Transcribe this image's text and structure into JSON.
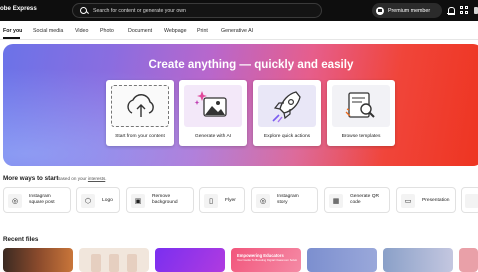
{
  "header": {
    "brand": "obe Express",
    "search_placeholder": "Search for content or generate your own",
    "premium_label": "Premium member"
  },
  "tabs": [
    {
      "label": "For you"
    },
    {
      "label": "Social media"
    },
    {
      "label": "Video"
    },
    {
      "label": "Photo"
    },
    {
      "label": "Document"
    },
    {
      "label": "Webpage"
    },
    {
      "label": "Print"
    },
    {
      "label": "Generative AI"
    }
  ],
  "hero": {
    "title": "Create anything — quickly and easily",
    "cards": [
      {
        "label": "Start from your content",
        "icon": "upload-cloud-icon"
      },
      {
        "label": "Generate with AI",
        "icon": "ai-image-icon"
      },
      {
        "label": "Explore quick actions",
        "icon": "rocket-icon"
      },
      {
        "label": "Browse templates",
        "icon": "template-search-icon"
      }
    ]
  },
  "more_ways": {
    "title": "More ways to start",
    "subtitle_prefix": "Based on your",
    "subtitle_link": "interests",
    "subtitle_suffix": ".",
    "items": [
      {
        "label": "Instagram square post",
        "icon": "instagram-icon",
        "glyph": "◎"
      },
      {
        "label": "Logo",
        "icon": "logo-icon",
        "glyph": "⬡"
      },
      {
        "label": "Remove background",
        "icon": "remove-background-icon",
        "glyph": "▣"
      },
      {
        "label": "Flyer",
        "icon": "flyer-icon",
        "glyph": "▯"
      },
      {
        "label": "Instagram story",
        "icon": "instagram-story-icon",
        "glyph": "◎"
      },
      {
        "label": "Generate QR code",
        "icon": "qr-code-icon",
        "glyph": "▦"
      },
      {
        "label": "Presentation",
        "icon": "presentation-icon",
        "glyph": "▭"
      }
    ]
  },
  "recent": {
    "title": "Recent files",
    "thumb_texts": [
      "Empowering Educators",
      "Your Guide To Boosting Digital Classroom Solutions"
    ]
  },
  "colors": {
    "topbar": "#0e0e0e",
    "hero_start": "#6b73e8",
    "hero_end": "#ee3420",
    "accent_purple": "#9b5de5"
  }
}
